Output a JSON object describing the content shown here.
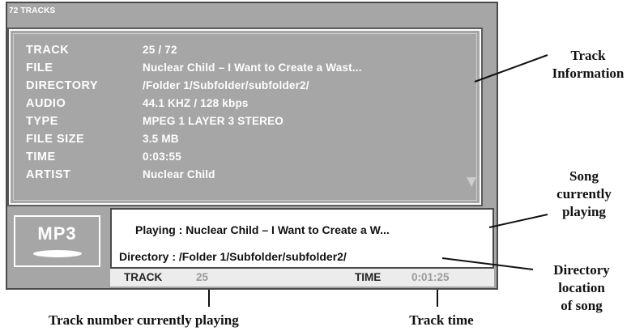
{
  "header": {
    "title": "72 TRACKS"
  },
  "track_info": {
    "rows": [
      {
        "label": "TRACK",
        "value": "25 / 72"
      },
      {
        "label": "FILE",
        "value": "Nuclear Child – I Want to Create a Wast..."
      },
      {
        "label": "DIRECTORY",
        "value": "/Folder 1/Subfolder/subfolder2/"
      },
      {
        "label": "AUDIO",
        "value": "44.1 KHZ / 128 kbps"
      },
      {
        "label": "TYPE",
        "value": "MPEG 1 LAYER 3 STEREO"
      },
      {
        "label": "FILE SIZE",
        "value": "3.5 MB"
      },
      {
        "label": "TIME",
        "value": "0:03:55"
      },
      {
        "label": "ARTIST",
        "value": "Nuclear Child"
      }
    ]
  },
  "format_badge": {
    "label": "MP3"
  },
  "now_playing": {
    "playing": "Playing : Nuclear Child – I Want to Create a W...",
    "directory": "Directory : /Folder 1/Subfolder/subfolder2/"
  },
  "status_bar": {
    "track_label": "TRACK",
    "track_value": "25",
    "time_label": "TIME",
    "time_value": "0:01:25"
  },
  "callouts": {
    "track_information": [
      "Track",
      "Information"
    ],
    "song_playing": [
      "Song",
      "currently",
      "playing"
    ],
    "directory_location": [
      "Directory",
      "location",
      "of song"
    ],
    "track_number": "Track number currently playing",
    "track_time": "Track time"
  },
  "colors": {
    "panel": "#a6a6a6",
    "border": "#4a4a4a",
    "text_light": "#ffffff"
  }
}
